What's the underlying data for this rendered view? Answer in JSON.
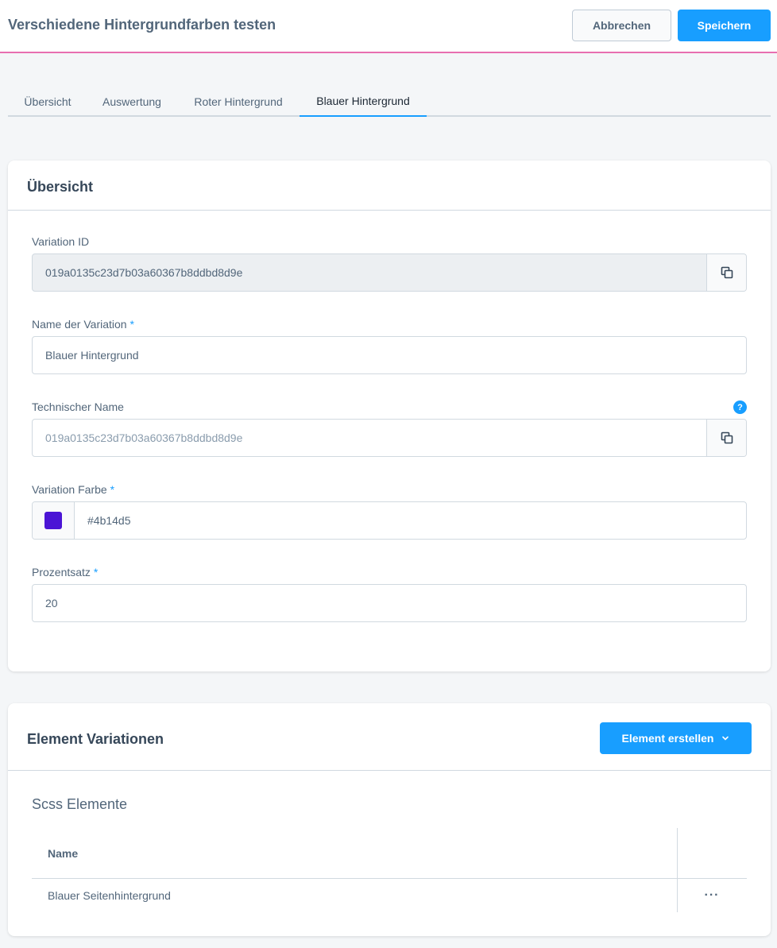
{
  "header": {
    "title": "Verschiedene Hintergrundfarben testen",
    "cancel_label": "Abbrechen",
    "save_label": "Speichern"
  },
  "tabs": [
    {
      "label": "Übersicht",
      "active": false
    },
    {
      "label": "Auswertung",
      "active": false
    },
    {
      "label": "Roter Hintergrund",
      "active": false
    },
    {
      "label": "Blauer Hintergrund",
      "active": true
    }
  ],
  "overview": {
    "title": "Übersicht",
    "variation_id": {
      "label": "Variation ID",
      "value": "019a0135c23d7b03a60367b8ddbd8d9e"
    },
    "name": {
      "label": "Name der Variation",
      "required": "*",
      "value": "Blauer Hintergrund"
    },
    "technical_name": {
      "label": "Technischer Name",
      "placeholder": "019a0135c23d7b03a60367b8ddbd8d9e",
      "help": "?"
    },
    "color": {
      "label": "Variation Farbe",
      "required": "*",
      "value": "#4b14d5"
    },
    "percentage": {
      "label": "Prozentsatz",
      "required": "*",
      "value": "20"
    }
  },
  "elements": {
    "title": "Element Variationen",
    "create_label": "Element erstellen",
    "subtitle": "Scss Elemente",
    "column_name": "Name",
    "rows": [
      {
        "name": "Blauer Seitenhintergrund"
      }
    ]
  },
  "colors": {
    "accent": "#189eff",
    "header_border": "#e86fb0",
    "swatch": "#4b14d5"
  }
}
